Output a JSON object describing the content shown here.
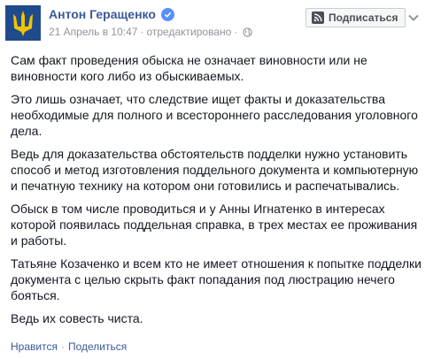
{
  "post": {
    "author": "Антон Геращенко",
    "date": "21 Апрель в 10:47",
    "edited": "отредактировано",
    "meta_separator": "·",
    "subscribe_label": "Подписаться",
    "paragraphs": [
      "Сам факт проведения обыска не означает виновности или не виновности кого либо из обыскиваемых.",
      "Это лишь означает, что следствие ищет факты и доказательства необходимые для полного и всестороннего расследования уголовного дела.",
      "Ведь для доказательства обстоятельств подделки нужно установить способ и метод изготовления поддельного документа и компьютерную и печатную технику на котором они готовились и распечатывались.",
      "Обыск в том числе проводиться и у Анны Игнатенко в интересах которой появилась поддельная справка, в трех местах ее проживания и работы.",
      "Татьяне Козаченко и всем кто не имеет отношения к попытке подделки документа с целью скрыть факт попадания под люстрацию нечего бояться.",
      "Ведь их совесть чиста."
    ],
    "actions": {
      "like": "Нравится",
      "share": "Поделиться",
      "separator": "·"
    }
  },
  "icons": {
    "avatar": "trident-emblem",
    "verified": "verified-badge-icon",
    "privacy": "globe-icon",
    "subscribe": "rss-icon",
    "menu": "chevron-down-icon"
  },
  "colors": {
    "link": "#3b5998",
    "meta": "#90949c",
    "text": "#141823",
    "avatar_bg": "#1f4a8c",
    "emblem": "#f2c300",
    "verified": "#5890ff"
  }
}
